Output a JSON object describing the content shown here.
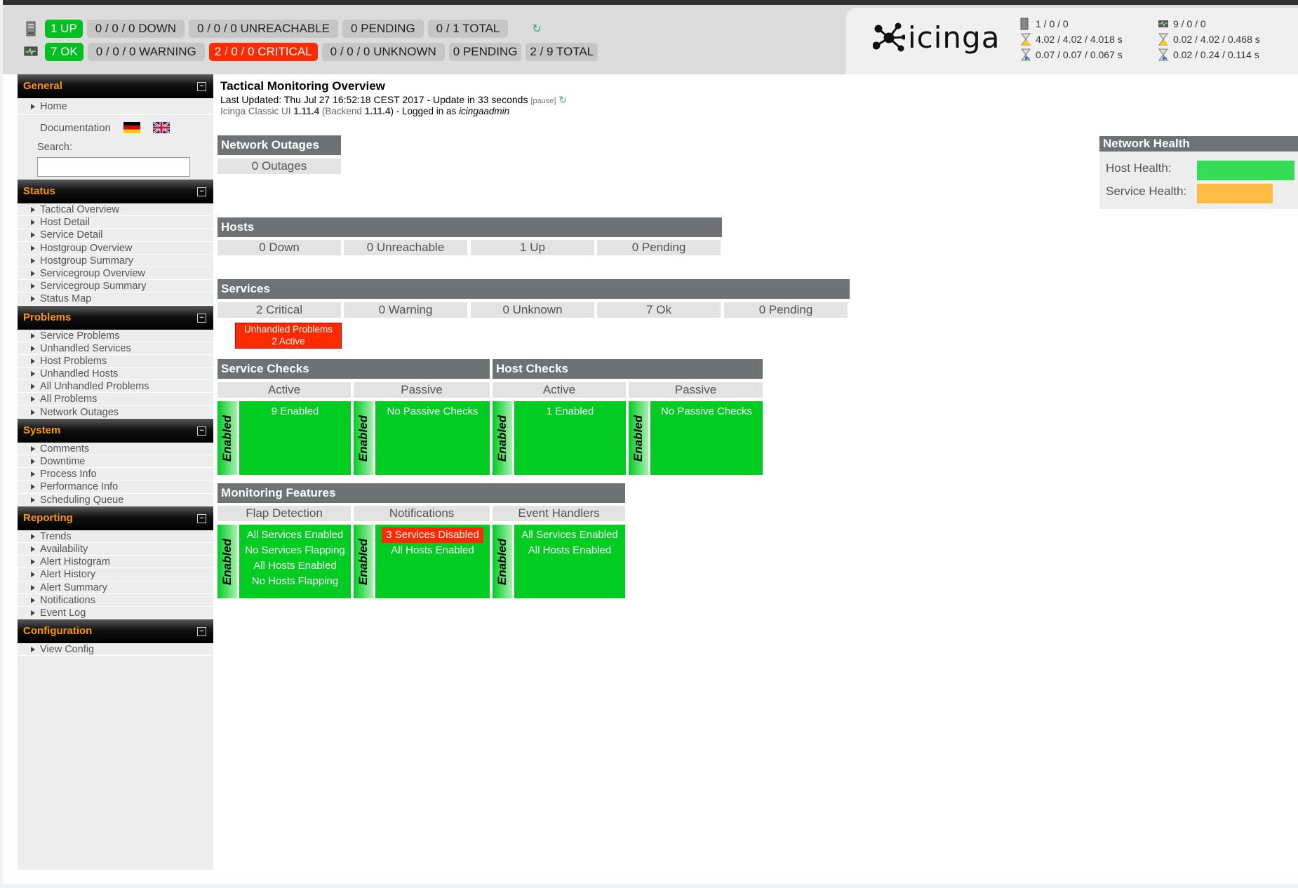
{
  "status_bar": {
    "hosts": {
      "up": "1 UP",
      "down": "0 / 0 / 0 DOWN",
      "unreachable": "0 / 0 / 0 UNREACHABLE",
      "pending": "0 PENDING",
      "total": "0 / 1 TOTAL"
    },
    "services": {
      "ok": "7 OK",
      "warning": "0 / 0 / 0 WARNING",
      "critical_a": "2",
      "critical_sep": " / ",
      "critical_b": "0",
      "critical_c": " / 0 CRITICAL",
      "unknown": "0 / 0 / 0 UNKNOWN",
      "pending": "0 PENDING",
      "total": "2 / 9 TOTAL"
    },
    "refresh_icon": "refresh-icon"
  },
  "logo": {
    "text": "icinga"
  },
  "perf": {
    "hosts": {
      "counts": "1 / 0 / 0",
      "latency": "4.02 / 4.02 / 4.018 s",
      "exec": "0.07 / 0.07 / 0.067 s"
    },
    "services": {
      "counts": "9 / 0 / 0",
      "latency": "0.02 / 4.02 / 0.468 s",
      "exec": "0.02 / 0.24 / 0.114 s"
    }
  },
  "sidebar": {
    "general": {
      "title": "General",
      "home": "Home",
      "documentation": "Documentation",
      "search_label": "Search:"
    },
    "status": {
      "title": "Status",
      "items": [
        "Tactical Overview",
        "Host Detail",
        "Service Detail",
        "Hostgroup Overview",
        "Hostgroup Summary",
        "Servicegroup Overview",
        "Servicegroup Summary",
        "Status Map"
      ]
    },
    "problems": {
      "title": "Problems",
      "items": [
        "Service Problems",
        "Unhandled Services",
        "Host Problems",
        "Unhandled Hosts",
        "All Unhandled Problems",
        "All Problems",
        "Network Outages"
      ]
    },
    "system": {
      "title": "System",
      "items": [
        "Comments",
        "Downtime",
        "Process Info",
        "Performance Info",
        "Scheduling Queue"
      ]
    },
    "reporting": {
      "title": "Reporting",
      "items": [
        "Trends",
        "Availability",
        "Alert Histogram",
        "Alert History",
        "Alert Summary",
        "Notifications",
        "Event Log"
      ]
    },
    "configuration": {
      "title": "Configuration",
      "items": [
        "View Config"
      ]
    }
  },
  "main": {
    "title": "Tactical Monitoring Overview",
    "updated": "Last Updated: Thu Jul 27 16:52:18 CEST 2017 - Update in 33 seconds",
    "pause": "[pause]",
    "version_prefix": "Icinga Classic UI",
    "version": "1.11.4",
    "backend_prefix": "(Backend",
    "backend_version": "1.11.4",
    "backend_suffix": ") - Logged in as",
    "user": "icingaadmin",
    "outages": {
      "title": "Network Outages",
      "value": "0 Outages"
    },
    "hosts": {
      "title": "Hosts",
      "cells": [
        "0 Down",
        "0 Unreachable",
        "1 Up",
        "0 Pending"
      ]
    },
    "services": {
      "title": "Services",
      "cells": [
        "2 Critical",
        "0 Warning",
        "0 Unknown",
        "7 Ok",
        "0 Pending"
      ],
      "unhandled_line1": "Unhandled Problems",
      "unhandled_line2": "2 Active"
    },
    "service_checks": {
      "title": "Service Checks",
      "active": "Active",
      "passive": "Passive",
      "active_value": "9 Enabled",
      "passive_value": "No Passive Checks"
    },
    "host_checks": {
      "title": "Host Checks",
      "active": "Active",
      "passive": "Passive",
      "active_value": "1 Enabled",
      "passive_value": "No Passive Checks"
    },
    "enabled_label": "Enabled",
    "features": {
      "title": "Monitoring Features",
      "flap": {
        "title": "Flap Detection",
        "lines": [
          "All Services Enabled",
          "No Services Flapping",
          "All Hosts Enabled",
          "No Hosts Flapping"
        ]
      },
      "notifications": {
        "title": "Notifications",
        "bad": "3 Services Disabled",
        "line2": "All Hosts Enabled"
      },
      "handlers": {
        "title": "Event Handlers",
        "lines": [
          "All Services Enabled",
          "All Hosts Enabled"
        ]
      }
    }
  },
  "network_health": {
    "title": "Network Health",
    "host_label": "Host Health:",
    "service_label": "Service Health:",
    "host_level": 1.0,
    "service_level": 0.78,
    "host_color": "#33dd55",
    "service_color": "#ffbb44"
  }
}
